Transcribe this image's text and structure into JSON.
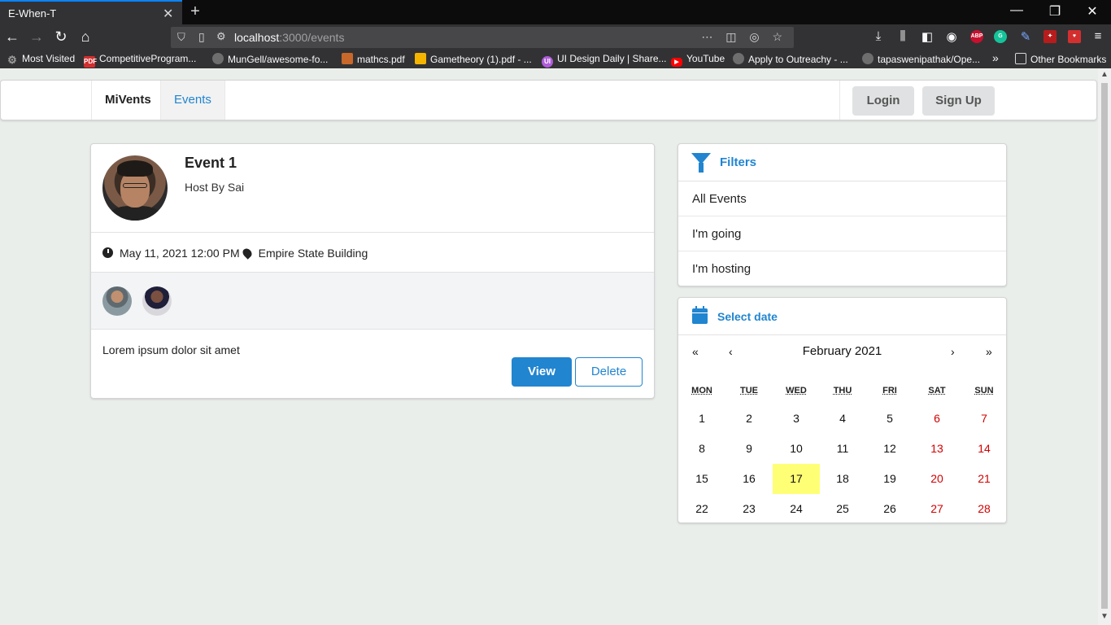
{
  "browser": {
    "tab_title": "E-When-T",
    "tab_close": "✕",
    "new_tab": "+",
    "url_host": "localhost",
    "url_path": ":3000/events",
    "win_min": "—",
    "win_max": "❐",
    "win_close": "✕",
    "bookmarks": [
      {
        "label": "Most Visited",
        "icon": "gear-icon",
        "color": "#9e9e9e"
      },
      {
        "label": "CompetitiveProgram...",
        "icon": "pdf-icon",
        "color": "#d32f2f"
      },
      {
        "label": "MunGell/awesome-fo...",
        "icon": "github-icon",
        "color": "#6e6e6e"
      },
      {
        "label": "mathcs.pdf",
        "icon": "shield-icon",
        "color": "#c8682a"
      },
      {
        "label": "Gametheory (1).pdf - ...",
        "icon": "drive-icon",
        "color": "#f4b400"
      },
      {
        "label": "UI Design Daily | Share...",
        "icon": "ui-icon",
        "color": "#b05cdb"
      },
      {
        "label": "YouTube",
        "icon": "youtube-icon",
        "color": "#ff0000"
      },
      {
        "label": "Apply to Outreachy - ...",
        "icon": "globe-icon",
        "color": "#6e6e6e"
      },
      {
        "label": "tapaswenipathak/Ope...",
        "icon": "github-icon",
        "color": "#6e6e6e"
      }
    ],
    "other_bookmarks": "Other Bookmarks"
  },
  "app": {
    "brand": "MiVents",
    "nav_events": "Events",
    "login": "Login",
    "signup": "Sign Up"
  },
  "event": {
    "title": "Event 1",
    "host": "Host By Sai",
    "datetime": "May 11, 2021 12:00 PM",
    "venue": "Empire State Building",
    "description": "Lorem ipsum dolor sit amet",
    "view_label": "View",
    "delete_label": "Delete"
  },
  "filters": {
    "title": "Filters",
    "items": [
      "All Events",
      "I'm going",
      "I'm hosting"
    ]
  },
  "calendar": {
    "title": "Select date",
    "month": "February 2021",
    "prev_year": "«",
    "prev_month": "‹",
    "next_month": "›",
    "next_year": "»",
    "weekdays": [
      "MON",
      "TUE",
      "WED",
      "THU",
      "FRI",
      "SAT",
      "SUN"
    ],
    "weeks": [
      [
        "1",
        "2",
        "3",
        "4",
        "5",
        "6",
        "7"
      ],
      [
        "8",
        "9",
        "10",
        "11",
        "12",
        "13",
        "14"
      ],
      [
        "15",
        "16",
        "17",
        "18",
        "19",
        "20",
        "21"
      ],
      [
        "22",
        "23",
        "24",
        "25",
        "26",
        "27",
        "28"
      ]
    ],
    "selected": "17",
    "accent": "#2185d0",
    "weekend_color": "#d10000",
    "highlight_color": "#ffff76"
  }
}
